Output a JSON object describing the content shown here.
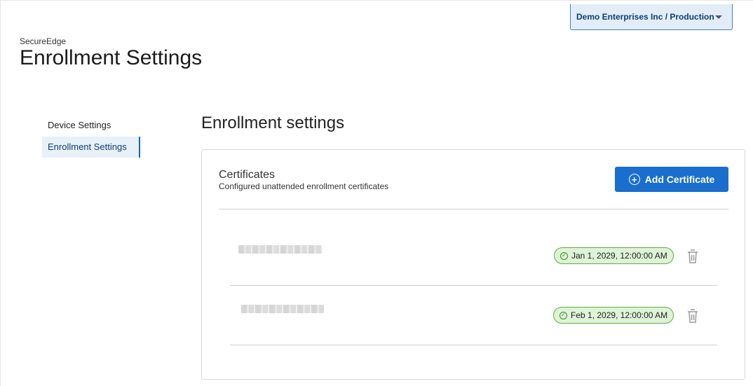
{
  "header": {
    "org_selector": "Demo Enterprises Inc / Production",
    "app_name": "SecureEdge",
    "page_title": "Enrollment Settings"
  },
  "sidebar": {
    "items": [
      {
        "label": "Device Settings",
        "active": false
      },
      {
        "label": "Enrollment Settings",
        "active": true
      }
    ]
  },
  "main": {
    "section_title": "Enrollment settings",
    "certificates": {
      "title": "Certificates",
      "subtitle": "Configured unattended enrollment certificates",
      "add_button_label": "Add Certificate",
      "add_button_icon": "plus-circle-icon",
      "items": [
        {
          "name_redacted": true,
          "expiry": "Jan 1, 2029, 12:00:00 AM",
          "status_icon": "check-circle-icon",
          "delete_icon": "trash-icon"
        },
        {
          "name_redacted": true,
          "expiry": "Feb 1, 2029, 12:00:00 AM",
          "status_icon": "check-circle-icon",
          "delete_icon": "trash-icon"
        }
      ]
    }
  },
  "colors": {
    "primary": "#1a6fce",
    "select_bg": "#e3edf7",
    "badge_bg": "#dff3d6",
    "badge_border": "#5fae45"
  }
}
